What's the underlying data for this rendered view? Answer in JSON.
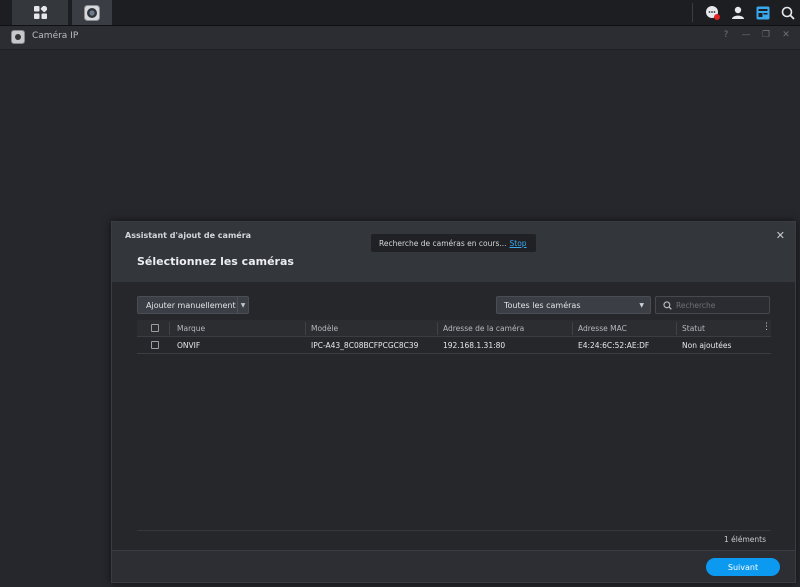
{
  "app": {
    "title": "Caméra IP"
  },
  "window_controls": [
    "?",
    "—",
    "❐",
    "✕"
  ],
  "dialog": {
    "title": "Assistant d'ajout de caméra",
    "subtitle": "Sélectionnez les caméras",
    "toast": {
      "text": "Recherche de caméras en cours...",
      "link": "Stop"
    },
    "add_button": "Ajouter manuellement",
    "filter": {
      "selected": "Toutes les caméras"
    },
    "search": {
      "placeholder": "Recherche"
    },
    "table": {
      "columns": [
        "Marque",
        "Modèle",
        "Adresse de la caméra",
        "Adresse MAC",
        "Statut"
      ],
      "rows": [
        {
          "brand": "ONVIF",
          "model": "IPC-A43_8C08BCFPCGC8C39",
          "address": "192.168.1.31:80",
          "mac": "E4:24:6C:52:AE:DF",
          "status": "Non ajoutées"
        }
      ]
    },
    "count": "1 éléments",
    "next_button": "Suivant"
  },
  "colors": {
    "accent": "#0b9af0",
    "link": "#3aa8ef",
    "background": "#25272c"
  },
  "icons": [
    "apps-grid-icon",
    "ip-camera-icon",
    "chat-notification-icon",
    "user-icon",
    "widgets-icon",
    "search-icon",
    "close-icon"
  ]
}
